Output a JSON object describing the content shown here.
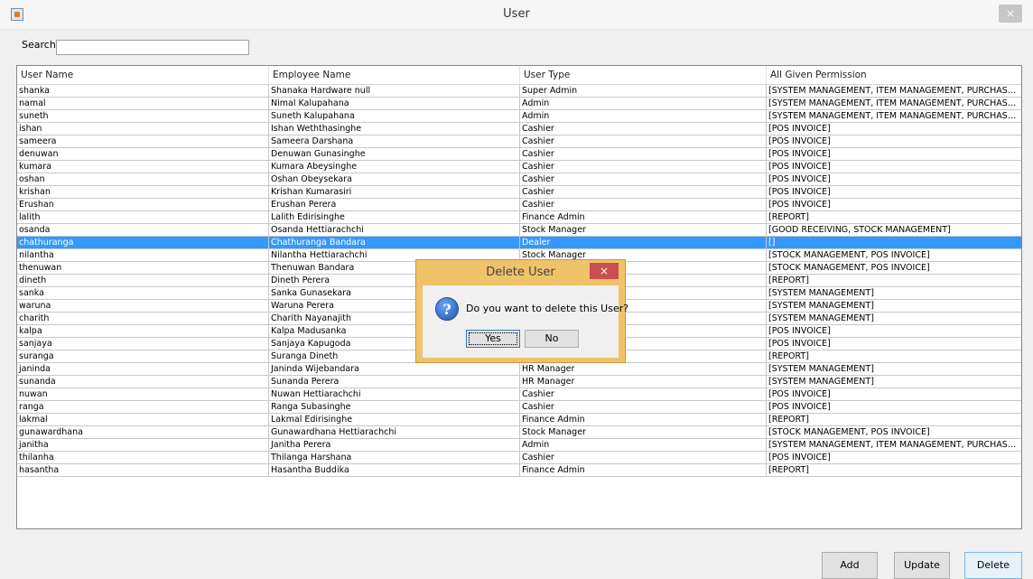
{
  "window": {
    "title": "User",
    "close_label": "×"
  },
  "search": {
    "label": "Search",
    "value": ""
  },
  "table": {
    "columns": [
      "User Name",
      "Employee Name",
      "User Type",
      "All Given Permission"
    ],
    "rows": [
      [
        "shanka",
        "Shanaka Hardware null",
        "Super Admin",
        "[SYSTEM MANAGEMENT, ITEM MANAGEMENT, PURCHASE ORDER..."
      ],
      [
        "namal",
        "Nimal Kalupahana",
        "Admin",
        "[SYSTEM MANAGEMENT, ITEM MANAGEMENT, PURCHASE ORDER..."
      ],
      [
        "suneth",
        "Suneth Kalupahana",
        "Admin",
        "[SYSTEM MANAGEMENT, ITEM MANAGEMENT, PURCHASE ORDER..."
      ],
      [
        "ishan",
        "Ishan Weththasinghe",
        "Cashier",
        "[POS INVOICE]"
      ],
      [
        "sameera",
        "Sameera Darshana",
        "Cashier",
        "[POS INVOICE]"
      ],
      [
        "denuwan",
        "Denuwan Gunasinghe",
        "Cashier",
        "[POS INVOICE]"
      ],
      [
        "kumara",
        "Kumara  Abeysinghe",
        "Cashier",
        "[POS INVOICE]"
      ],
      [
        "oshan",
        "Oshan Obeysekara",
        "Cashier",
        "[POS INVOICE]"
      ],
      [
        "krishan",
        "Krishan Kumarasiri",
        "Cashier",
        "[POS INVOICE]"
      ],
      [
        "Erushan",
        "Erushan Perera",
        "Cashier",
        "[POS INVOICE]"
      ],
      [
        "lalith",
        "Lalith Edirisinghe",
        "Finance Admin",
        "[REPORT]"
      ],
      [
        "osanda",
        "Osanda Hettiarachchi",
        "Stock Manager",
        "[GOOD RECEIVING, STOCK MANAGEMENT]"
      ],
      [
        "chathuranga",
        "Chathuranga Bandara",
        "Dealer",
        "[]"
      ],
      [
        "nilantha",
        "Nilantha Hettiarachchi",
        "Stock Manager",
        "[STOCK MANAGEMENT, POS INVOICE]"
      ],
      [
        "thenuwan",
        "Thenuwan Bandara",
        "",
        "[STOCK MANAGEMENT, POS INVOICE]"
      ],
      [
        "dineth",
        "Dineth Perera",
        "",
        "[REPORT]"
      ],
      [
        "sanka",
        "Sanka Gunasekara",
        "",
        "[SYSTEM MANAGEMENT]"
      ],
      [
        "waruna",
        "Waruna Perera",
        "",
        "[SYSTEM MANAGEMENT]"
      ],
      [
        "charith",
        "Charith Nayanajith",
        "",
        "[SYSTEM MANAGEMENT]"
      ],
      [
        "kalpa",
        "Kalpa Madusanka",
        "",
        "[POS INVOICE]"
      ],
      [
        "sanjaya",
        "Sanjaya Kapugoda",
        "",
        "[POS INVOICE]"
      ],
      [
        "suranga",
        "Suranga Dineth",
        "",
        "[REPORT]"
      ],
      [
        "janinda",
        "Janinda Wijebandara",
        "HR Manager",
        "[SYSTEM MANAGEMENT]"
      ],
      [
        "sunanda",
        "Sunanda Perera",
        "HR Manager",
        "[SYSTEM MANAGEMENT]"
      ],
      [
        "nuwan",
        "Nuwan Hettiarachchi",
        "Cashier",
        "[POS INVOICE]"
      ],
      [
        "ranga",
        "Ranga Subasinghe",
        "Cashier",
        "[POS INVOICE]"
      ],
      [
        "lakmal",
        "Lakmal Edirisinghe",
        "Finance Admin",
        "[REPORT]"
      ],
      [
        "gunawardhana",
        "Gunawardhana  Hettiarachchi",
        "Stock Manager",
        "[STOCK MANAGEMENT, POS INVOICE]"
      ],
      [
        "janitha",
        "Janitha  Perera",
        "Admin",
        "[SYSTEM MANAGEMENT, ITEM MANAGEMENT, PURCHASE ORDER..."
      ],
      [
        "thilanha",
        "Thilanga Harshana",
        "Cashier",
        "[POS INVOICE]"
      ],
      [
        "hasantha",
        "Hasantha  Buddika",
        "Finance Admin",
        "[REPORT]"
      ]
    ],
    "selected_row": 12
  },
  "buttons": {
    "add": "Add",
    "update": "Update",
    "delete": "Delete"
  },
  "dialog": {
    "title": "Delete User",
    "close_label": "×",
    "message": "Do you want to delete this User?",
    "yes": "Yes",
    "no": "No",
    "icon": "question-icon"
  },
  "colors": {
    "selection": "#3399ff",
    "dialog_frame": "#f0c26a",
    "dialog_close": "#c75050"
  }
}
